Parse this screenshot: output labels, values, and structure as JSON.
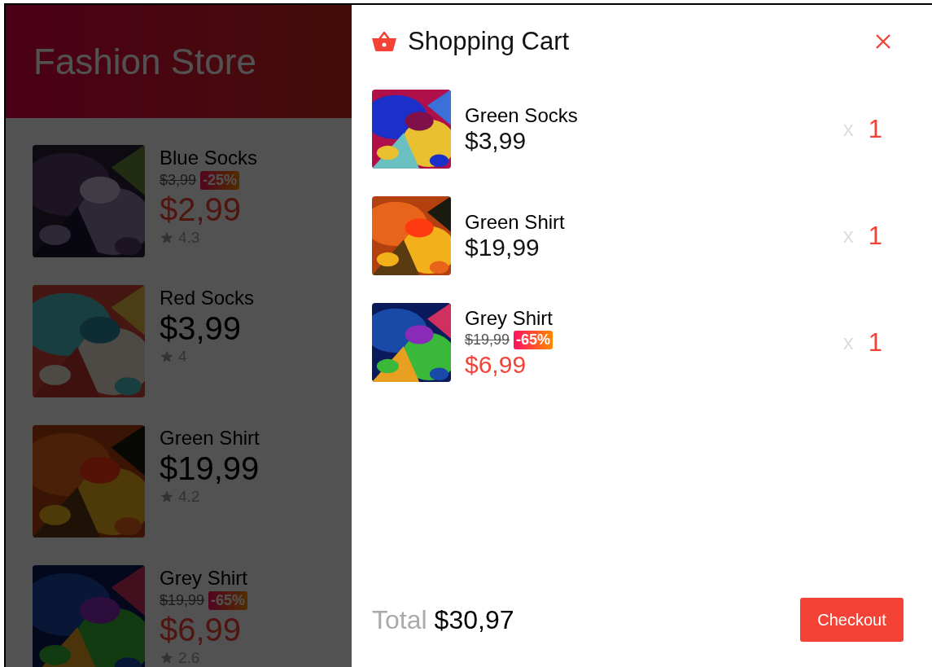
{
  "store": {
    "title": "Fashion Store",
    "products": [
      {
        "name": "Blue Socks",
        "old_price": "$3,99",
        "discount": "-25%",
        "price": "$2,99",
        "rating": "4.3"
      },
      {
        "name": "Red Socks",
        "price": "$3,99",
        "rating": "4"
      },
      {
        "name": "Green Shirt",
        "price": "$19,99",
        "rating": "4.2"
      },
      {
        "name": "Grey Shirt",
        "old_price": "$19,99",
        "discount": "-65%",
        "price": "$6,99",
        "rating": "2.6"
      }
    ]
  },
  "cart": {
    "title": "Shopping Cart",
    "items": [
      {
        "name": "Green Socks",
        "price": "$3,99",
        "times": "x",
        "quantity": "1"
      },
      {
        "name": "Green Shirt",
        "price": "$19,99",
        "times": "x",
        "quantity": "1"
      },
      {
        "name": "Grey Shirt",
        "old_price": "$19,99",
        "discount": "-65%",
        "price": "$6,99",
        "times": "x",
        "quantity": "1"
      }
    ],
    "total_label": "Total",
    "total": "$30,97",
    "checkout": "Checkout"
  }
}
